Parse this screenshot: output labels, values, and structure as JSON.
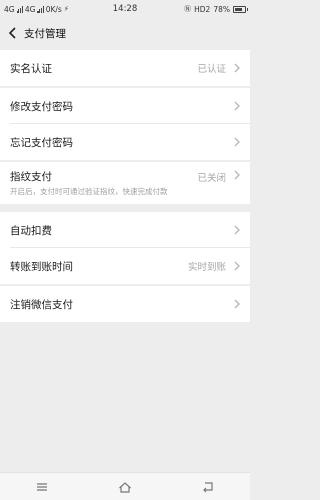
{
  "status_bar": {
    "left_text": "4G",
    "left_text_2": "4G",
    "speed": "0K/s",
    "time": "14:28",
    "hd": "HD2",
    "battery": "78%"
  },
  "nav": {
    "title": "支付管理"
  },
  "rows": {
    "real_name": {
      "label": "实名认证",
      "value": "已认证"
    },
    "change_password": {
      "label": "修改支付密码"
    },
    "forgot_password": {
      "label": "忘记支付密码"
    },
    "fingerprint": {
      "label": "指纹支付",
      "value": "已关闭",
      "hint": "开启后，支付时可通过验证指纹，快速完成付款"
    },
    "auto_deduct": {
      "label": "自动扣费"
    },
    "transfer_time": {
      "label": "转账到账时间",
      "value": "实时到账"
    },
    "cancel_wechat_pay": {
      "label": "注销微信支付"
    }
  }
}
